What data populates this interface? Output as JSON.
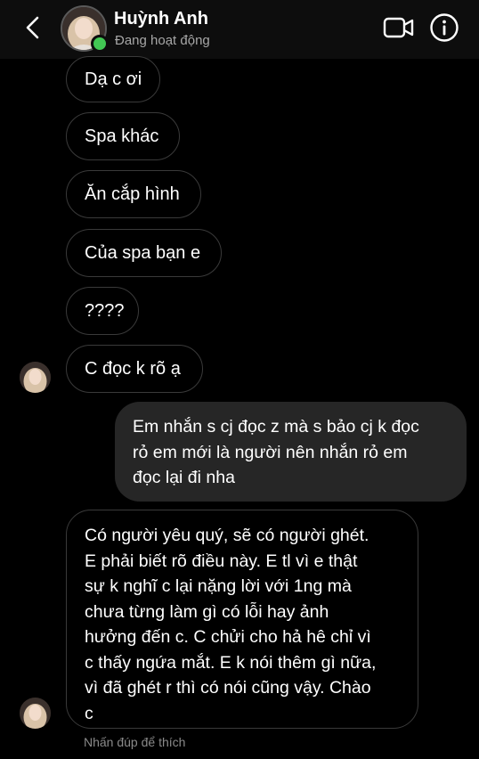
{
  "header": {
    "name": "Huỳnh Anh",
    "status": "Đang hoạt động",
    "online_color": "#42c754",
    "icons": [
      "back-arrow-icon",
      "video-call-icon",
      "info-icon"
    ]
  },
  "messages": [
    {
      "from": "them",
      "text": "Dạ c ơi"
    },
    {
      "from": "them",
      "text": "Spa khác"
    },
    {
      "from": "them",
      "text": "Ăn cắp hình"
    },
    {
      "from": "them",
      "text": "Của spa bạn e"
    },
    {
      "from": "them",
      "text": "????"
    },
    {
      "from": "them",
      "text": "C đọc k rõ ạ"
    },
    {
      "from": "me",
      "lines": [
        "Em nhắn s cj đọc z mà s bảo cj k đọc",
        "rỏ em mới là người nên nhắn rỏ em",
        "đọc lại đi nha"
      ]
    },
    {
      "from": "them",
      "lines": [
        "Có người yêu quý, sẽ có người ghét.",
        "E phải biết rõ điều này. E tl vì e thật",
        "sự k nghĩ c lại nặng lời với 1ng mà",
        "chưa từng làm gì có lỗi hay ảnh",
        "hưởng đến c. C chửi cho hả hê chỉ vì",
        "c thấy ngứa mắt. E k nói thêm gì nữa,",
        "vì đã ghét r thì có nói cũng vậy. Chào",
        "c"
      ]
    }
  ],
  "hint": "Nhấn đúp để thích"
}
